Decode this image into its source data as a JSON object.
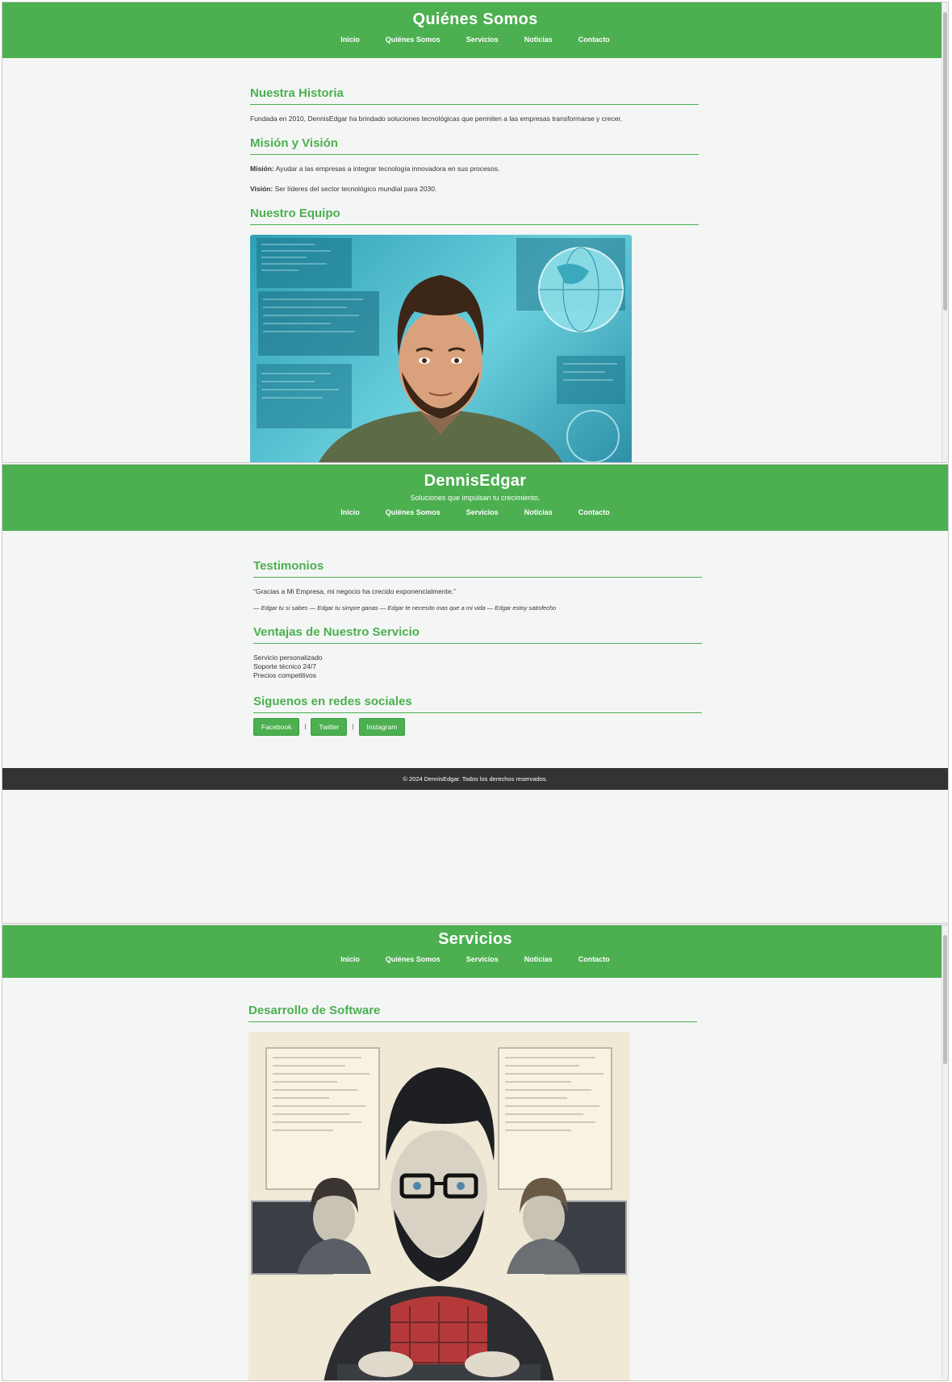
{
  "nav": [
    "Inicio",
    "Quiénes Somos",
    "Servicios",
    "Noticias",
    "Contacto"
  ],
  "colors": {
    "brand_green": "#4caf50",
    "footer_bg": "#333333",
    "page_bg": "#f4f6f5"
  },
  "panel1": {
    "title": "Quiénes Somos",
    "historia_heading": "Nuestra Historia",
    "historia_text": "Fundada en 2010, DennisEdgar ha brindado soluciones tecnológicas que permiten a las empresas transformarse y crecer.",
    "mision_heading": "Misión y Visión",
    "mision_label": "Misión:",
    "mision_text": "Ayudar a las empresas a integrar tecnología innovadora en sus procesos.",
    "vision_label": "Visión:",
    "vision_text": "Ser líderes del sector tecnológico mundial para 2030.",
    "equipo_heading": "Nuestro Equipo"
  },
  "panel2": {
    "title": "DennisEdgar",
    "subtitle": "Soluciones que impulsan tu crecimiento.",
    "testimonios_heading": "Testimonios",
    "testimonio_quote": "“Gracias a Mi Empresa, mi negocio ha crecido exponencialmente.”",
    "testimonio_authors": "— Edgar tu si sabes — Edgar tu simpre ganas — Edgar te necesito mas que a mi vida — Edgar estoy satisfecho",
    "ventajas_heading": "Ventajas de Nuestro Servicio",
    "ventajas": [
      "Servicio personalizado",
      "Soporte técnico 24/7",
      "Precios competitivos"
    ],
    "social_heading": "Siguenos en redes sociales",
    "social_buttons": [
      "Facebook",
      "Twitter",
      "Instagram"
    ],
    "social_separator": "|",
    "footer": "© 2024 DennisEdgar. Todos los derechos reservados."
  },
  "panel3": {
    "title": "Servicios",
    "desarrollo_heading": "Desarrollo de Software"
  }
}
